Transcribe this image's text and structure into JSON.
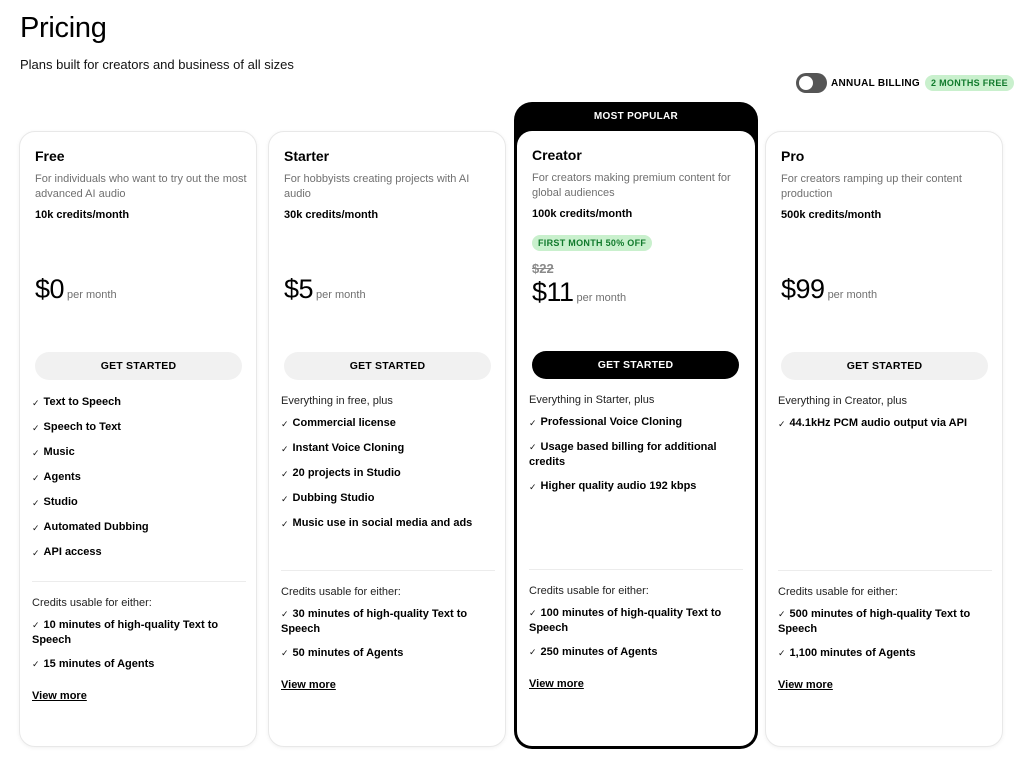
{
  "header": {
    "title": "Pricing",
    "subtitle": "Plans built for creators and business of all sizes"
  },
  "billing": {
    "label": "ANNUAL BILLING",
    "badge": "2 MONTHS FREE",
    "annual_enabled": false
  },
  "colors": {
    "accent": "#000000",
    "badge_bg": "#c9f0cd",
    "badge_text": "#117a2c"
  },
  "plans": [
    {
      "name": "Free",
      "description": "For individuals who want to try out the most advanced AI audio",
      "credits": "10k credits/month",
      "price": "$0",
      "period": "per month",
      "cta": "GET STARTED",
      "features_intro": "",
      "features": [
        "Text to Speech",
        "Speech to Text",
        "Music",
        "Agents",
        "Studio",
        "Automated Dubbing",
        "API access"
      ],
      "credits_head": "Credits usable for either:",
      "credit_items": [
        "10 minutes of high-quality Text to Speech",
        "15 minutes of Agents"
      ],
      "view_more": "View more"
    },
    {
      "name": "Starter",
      "description": "For hobbyists creating projects with AI audio",
      "credits": "30k credits/month",
      "price": "$5",
      "period": "per month",
      "cta": "GET STARTED",
      "features_intro": "Everything in free, plus",
      "features": [
        "Commercial license",
        "Instant Voice Cloning",
        "20 projects in Studio",
        "Dubbing Studio",
        "Music use in social media and ads"
      ],
      "credits_head": "Credits usable for either:",
      "credit_items": [
        "30 minutes of high-quality Text to Speech",
        "50 minutes of Agents"
      ],
      "view_more": "View more"
    },
    {
      "name": "Creator",
      "popular_label": "MOST POPULAR",
      "description": "For creators making premium content for global audiences",
      "credits": "100k credits/month",
      "promo": "FIRST MONTH 50% OFF",
      "old_price": "$22",
      "price": "$11",
      "period": "per month",
      "cta": "GET STARTED",
      "features_intro": "Everything in Starter, plus",
      "features": [
        "Professional Voice Cloning",
        "Usage based billing for additional credits",
        "Higher quality audio 192 kbps"
      ],
      "credits_head": "Credits usable for either:",
      "credit_items": [
        "100 minutes of high-quality Text to Speech",
        "250 minutes of Agents"
      ],
      "view_more": "View more"
    },
    {
      "name": "Pro",
      "description": "For creators ramping up their content production",
      "credits": "500k credits/month",
      "price": "$99",
      "period": "per month",
      "cta": "GET STARTED",
      "features_intro": "Everything in Creator, plus",
      "features": [
        "44.1kHz PCM audio output via API"
      ],
      "credits_head": "Credits usable for either:",
      "credit_items": [
        "500 minutes of high-quality Text to Speech",
        "1,100 minutes of Agents"
      ],
      "view_more": "View more"
    }
  ]
}
